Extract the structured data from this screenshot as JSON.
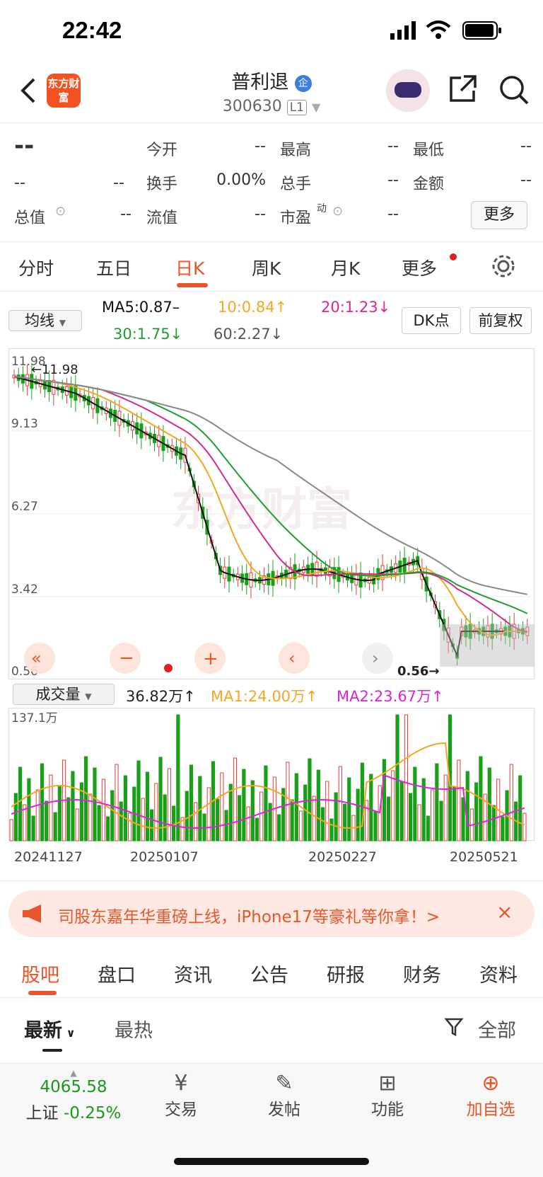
{
  "status": {
    "time": "22:42"
  },
  "header": {
    "logo": "东方财富",
    "title": "普利退",
    "code": "300630",
    "level": "L1",
    "badge": "企"
  },
  "quote": {
    "price": "--",
    "change": "--",
    "change_pct": "--",
    "rows": [
      [
        {
          "l": "今开",
          "v": "--"
        },
        {
          "l": "最高",
          "v": "--"
        },
        {
          "l": "最低",
          "v": "--"
        }
      ],
      [
        {
          "l": "换手",
          "v": "0.00%"
        },
        {
          "l": "总手",
          "v": "--"
        },
        {
          "l": "金额",
          "v": "--"
        }
      ],
      [
        {
          "l": "流值",
          "v": "--"
        },
        {
          "l": "市盈",
          "v": "--"
        }
      ]
    ],
    "zongzhi_label": "总值",
    "zongzhi_value": "--",
    "shiying_sup": "动",
    "more": "更多"
  },
  "tabs": [
    "分时",
    "五日",
    "日K",
    "周K",
    "月K",
    "更多"
  ],
  "ma": {
    "selector": "均线",
    "ma5": "MA5:0.87–",
    "ma10": "10:0.84↑",
    "ma20": "20:1.23↓",
    "ma30": "30:1.75↓",
    "ma60": "60:2.27↓",
    "dk": "DK点",
    "fq": "前复权"
  },
  "colors": {
    "up": "#e83b3b",
    "down": "#19a019",
    "ma5": "#111111",
    "ma10": "#f5a623",
    "ma20": "#d9288a",
    "ma30": "#1f9e2e",
    "ma60": "#888888",
    "accent": "#e8552a"
  },
  "kchart": {
    "y_labels": [
      "11.98",
      "9.13",
      "6.27",
      "3.42",
      "0.56"
    ],
    "max_label": "←11.98",
    "min_label": "0.56→",
    "watermark": "东方财富"
  },
  "volume": {
    "selector": "成交量",
    "vol": "36.82万↑",
    "ma1": "MA1:24.00万↑",
    "ma2": "MA2:23.67万↑",
    "max": "137.1万",
    "dates": [
      "20241127",
      "20250107",
      "20250227",
      "20250521"
    ]
  },
  "banner": {
    "text": "司股东嘉年华重磅上线，iPhone17等豪礼等你拿！>"
  },
  "subtabs": [
    "股吧",
    "盘口",
    "资讯",
    "公告",
    "研报",
    "财务",
    "资料"
  ],
  "filter": {
    "newest": "最新",
    "hottest": "最热",
    "all": "全部"
  },
  "bottom": {
    "index_value": "4065.58",
    "index_name": "上证",
    "index_change": "-0.25%",
    "items": [
      "交易",
      "发帖",
      "功能",
      "加自选"
    ]
  }
}
